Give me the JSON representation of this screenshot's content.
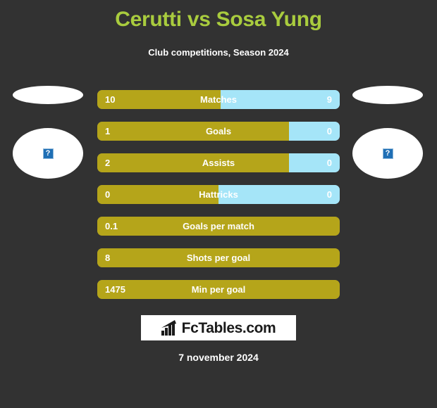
{
  "header": {
    "title": "Cerutti vs Sosa Yung",
    "subtitle": "Club competitions, Season 2024"
  },
  "colors": {
    "background": "#323232",
    "title_green": "#a9cc3e",
    "home_gold": "#b5a51a",
    "away_blue": "#a5e5f8",
    "text_white": "#ffffff"
  },
  "players": {
    "home": {
      "avatar_alt": "?"
    },
    "away": {
      "avatar_alt": "?"
    }
  },
  "stats": [
    {
      "label": "Matches",
      "home": "10",
      "away": "9",
      "home_pct": 51,
      "split": true
    },
    {
      "label": "Goals",
      "home": "1",
      "away": "0",
      "home_pct": 79,
      "split": true
    },
    {
      "label": "Assists",
      "home": "2",
      "away": "0",
      "home_pct": 79,
      "split": true
    },
    {
      "label": "Hattricks",
      "home": "0",
      "away": "0",
      "home_pct": 50,
      "split": true
    },
    {
      "label": "Goals per match",
      "home": "0.1",
      "away": "",
      "home_pct": 100,
      "split": false
    },
    {
      "label": "Shots per goal",
      "home": "8",
      "away": "",
      "home_pct": 100,
      "split": false
    },
    {
      "label": "Min per goal",
      "home": "1475",
      "away": "",
      "home_pct": 100,
      "split": false
    }
  ],
  "footer": {
    "logo_text": "FcTables.com",
    "logo_icon": "bar-chart-icon",
    "date": "7 november 2024"
  },
  "chart_data": {
    "type": "bar",
    "title": "Cerutti vs Sosa Yung",
    "subtitle": "Club competitions, Season 2024",
    "categories": [
      "Matches",
      "Goals",
      "Assists",
      "Hattricks",
      "Goals per match",
      "Shots per goal",
      "Min per goal"
    ],
    "series": [
      {
        "name": "Cerutti",
        "values": [
          10,
          1,
          2,
          0,
          0.1,
          8,
          1475
        ]
      },
      {
        "name": "Sosa Yung",
        "values": [
          9,
          0,
          0,
          0,
          null,
          null,
          null
        ]
      }
    ],
    "orientation": "horizontal",
    "grid": false,
    "legend": "none"
  }
}
